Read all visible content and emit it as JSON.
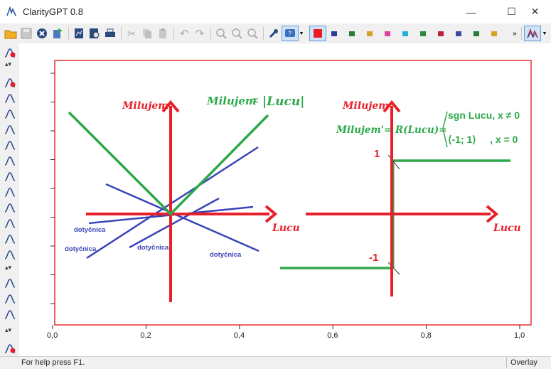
{
  "window": {
    "title": "ClarityGPT 0.8",
    "minimize_icon": "minimize-icon",
    "maximize_icon": "maximize-icon",
    "close_icon": "close-icon"
  },
  "toolbar": {
    "icons": [
      "folder-open-icon",
      "save-icon",
      "close-file-icon",
      "export-icon",
      "report-icon",
      "print-preview-icon",
      "print-icon",
      "cut-icon",
      "copy-icon",
      "paste-icon",
      "undo-icon",
      "redo-icon",
      "zoom-in-icon",
      "zoom-area-icon",
      "zoom-out-icon",
      "wrench-icon",
      "help-icon",
      "dropdown-icon",
      "color-red-icon"
    ],
    "swatches": [
      "#2e3a9a",
      "#2a7a3a",
      "#d8a020",
      "#e040a0",
      "#20b0d8",
      "#2a8a3a",
      "#c02040",
      "#3a4aa0",
      "#2a7a3a",
      "#d8a020"
    ],
    "more_icon": "chevron-double-right-icon",
    "overlay_icon": "overlay-chart-icon"
  },
  "sidebar": {
    "icons": [
      "tool-calibrate-icon",
      "collapse-icon",
      "peak-delete-icon",
      "peak-icon-1",
      "peak-icon-2",
      "peak-icon-3",
      "peak-icon-4",
      "peak-icon-5",
      "peak-icon-6",
      "peak-icon-7",
      "peak-icon-8",
      "peak-icon-9",
      "peak-icon-10",
      "peak-icon-11",
      "collapse-icon",
      "peak-icon-12",
      "peak-icon-13",
      "peak-icon-14",
      "collapse-icon",
      "tool-calibrate-icon"
    ]
  },
  "chart_data": {
    "type": "line",
    "x_axis": {
      "min": 0.0,
      "max": 1.0,
      "ticks": [
        "0,0",
        "0,2",
        "0,4",
        "0,6",
        "0,8",
        "1,0"
      ]
    },
    "left_graph": {
      "function_label_lhs": "Milujem",
      "function_label_rhs": "|Lucu|",
      "x_axis_label": "Lucu",
      "y_axis_label": "Milujem",
      "tangent_labels": [
        "dotyčnica",
        "dotyčnica",
        "dotyčnica",
        "dotyčnica"
      ]
    },
    "right_graph": {
      "x_axis_label": "Lucu",
      "y_axis_label": "Milujem",
      "derivative_lhs": "Milujem'= R(Lucu)=",
      "case1_text": "sgn Lucu, x ≠ 0",
      "case2_text": "⟨-1; 1⟩     , x = 0",
      "value_pos": "1",
      "value_neg": "-1"
    },
    "colors": {
      "axis": "#e8202a",
      "function": "#2ea84a",
      "tangent": "#3a44b8",
      "frame": "#e83030"
    }
  },
  "statusbar": {
    "help": "For help press F1.",
    "mode": "Overlay"
  }
}
